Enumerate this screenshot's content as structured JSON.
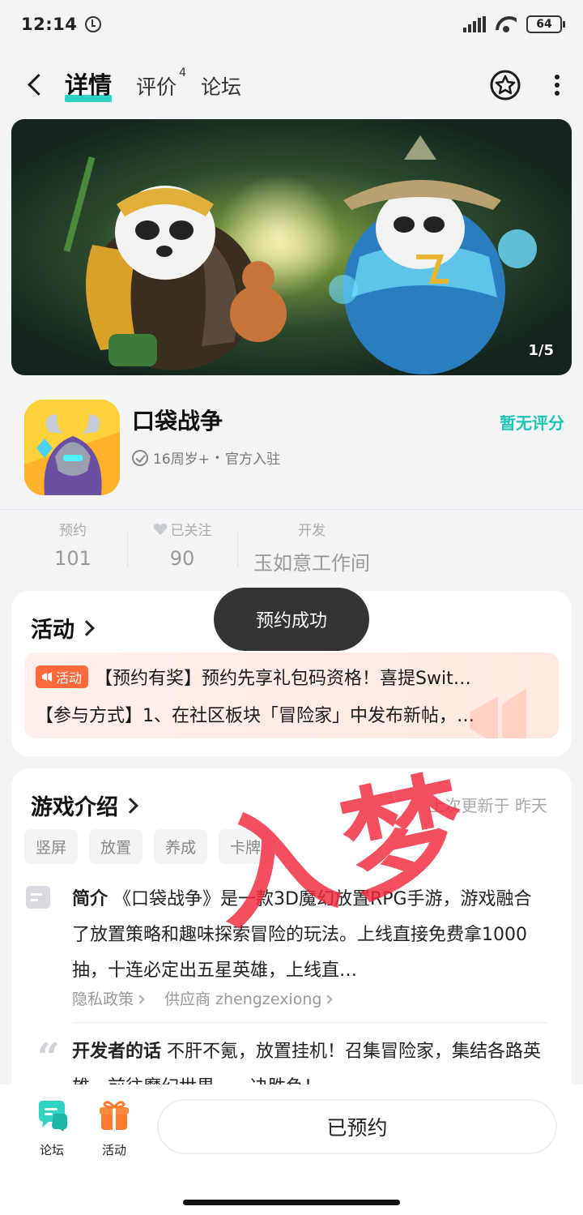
{
  "status_bar": {
    "time": "12:14",
    "battery": "64"
  },
  "nav": {
    "tabs": [
      {
        "label": "详情",
        "badge": ""
      },
      {
        "label": "评价",
        "badge": "4"
      },
      {
        "label": "论坛",
        "badge": ""
      }
    ]
  },
  "banner": {
    "counter": "1/5"
  },
  "game": {
    "title": "口袋战争",
    "age": "16周岁+",
    "dot": "•",
    "official": "官方入驻",
    "rating": "暂无评分"
  },
  "stats": [
    {
      "label": "预约",
      "value": "101"
    },
    {
      "label": "已关注",
      "value": "90"
    },
    {
      "label": "开发",
      "value": "玉如意工作间"
    }
  ],
  "activity": {
    "title": "活动",
    "tag": "活动",
    "line1": "【预约有奖】预约先享礼包码资格！喜提Swit…",
    "line2": "【参与方式】1、在社区板块「冒险家」中发布新帖，…"
  },
  "toast": "预约成功",
  "intro": {
    "title": "游戏介绍",
    "update": "上次更新于 昨天",
    "tags": [
      "竖屏",
      "放置",
      "养成",
      "卡牌"
    ],
    "summary_label": "简介",
    "summary": "《口袋战争》是一款3D魔幻放置RPG手游，游戏融合了放置策略和趣味探索冒险的玩法。上线直接免费拿1000抽，十连必定出五星英雄，上线直…",
    "privacy": "隐私政策",
    "supplier": "供应商 zhengzexiong",
    "dev_label": "开发者的话",
    "dev_words": "不肝不氪，放置挂机！召集冒险家，集结各路英雄，前往魔幻世界，一决胜负！"
  },
  "watermark": "入梦",
  "bottom": {
    "forum": "论坛",
    "activity": "活动",
    "reserved": "已预约"
  },
  "colors": {
    "accent": "#2ed3c4",
    "rating": "#1fc3b3",
    "activity_tag": "#ff6a3d",
    "watermark": "#f0283c"
  }
}
